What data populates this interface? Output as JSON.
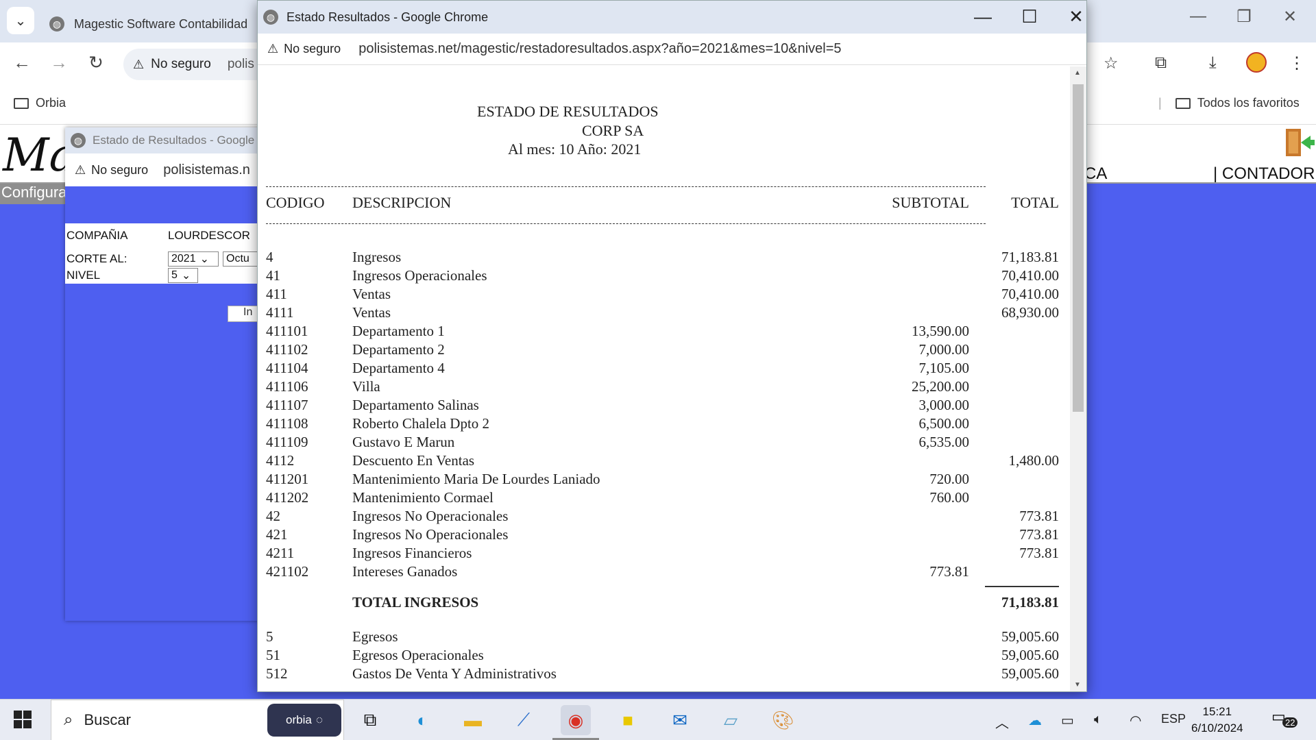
{
  "background_window": {
    "tab_title": "Magestic Software Contabilidad",
    "omnibox_warning": "No seguro",
    "omnibox_url": "polis",
    "bookmark_orbia": "Orbia",
    "bookmark_all": "Todos los favoritos"
  },
  "app": {
    "logo_text": "Ma",
    "menu_ca": "CA",
    "menu_contador": "| CONTADOR",
    "config_menu": "Configura"
  },
  "popup2": {
    "title": "Estado de Resultados - Google",
    "warning": "No seguro",
    "url": "polisistemas.n",
    "form": {
      "company_label": "COMPAÑIA",
      "company_value": "LOURDESCOR",
      "corte_label": "CORTE AL:",
      "year_value": "2021",
      "month_value": "Octu",
      "nivel_label": "NIVEL",
      "nivel_value": "5"
    },
    "button_label": "In"
  },
  "popup": {
    "title": "Estado Resultados - Google Chrome",
    "warning": "No seguro",
    "url": "polisistemas.net/magestic/restadoresultados.aspx?año=2021&mes=10&nivel=5"
  },
  "report": {
    "title": "ESTADO DE RESULTADOS",
    "company": "CORP SA",
    "period": "Al mes: 10 Año: 2021",
    "headers": {
      "codigo": "CODIGO",
      "descripcion": "DESCRIPCION",
      "subtotal": "SUBTOTAL",
      "total": "TOTAL"
    },
    "rows": [
      {
        "code": "4",
        "desc": "Ingresos",
        "subtotal": "",
        "total": "71,183.81"
      },
      {
        "code": "41",
        "desc": "Ingresos Operacionales",
        "subtotal": "",
        "total": "70,410.00"
      },
      {
        "code": "411",
        "desc": "Ventas",
        "subtotal": "",
        "total": "70,410.00"
      },
      {
        "code": "4111",
        "desc": "Ventas",
        "subtotal": "",
        "total": "68,930.00"
      },
      {
        "code": "411101",
        "desc": "Departamento 1",
        "subtotal": "13,590.00",
        "total": ""
      },
      {
        "code": "411102",
        "desc": "Departamento 2",
        "subtotal": "7,000.00",
        "total": ""
      },
      {
        "code": "411104",
        "desc": "Departamento 4",
        "subtotal": "7,105.00",
        "total": ""
      },
      {
        "code": "411106",
        "desc": "Villa",
        "subtotal": "25,200.00",
        "total": ""
      },
      {
        "code": "411107",
        "desc": "Departamento Salinas",
        "subtotal": "3,000.00",
        "total": ""
      },
      {
        "code": "411108",
        "desc": "Roberto Chalela Dpto 2",
        "subtotal": "6,500.00",
        "total": ""
      },
      {
        "code": "411109",
        "desc": "Gustavo E Marun",
        "subtotal": "6,535.00",
        "total": ""
      },
      {
        "code": "4112",
        "desc": "Descuento En Ventas",
        "subtotal": "",
        "total": "1,480.00"
      },
      {
        "code": "411201",
        "desc": "Mantenimiento Maria De Lourdes Laniado",
        "subtotal": "720.00",
        "total": ""
      },
      {
        "code": "411202",
        "desc": "Mantenimiento Cormael",
        "subtotal": "760.00",
        "total": ""
      },
      {
        "code": "42",
        "desc": "Ingresos No Operacionales",
        "subtotal": "",
        "total": "773.81"
      },
      {
        "code": "421",
        "desc": "Ingresos No Operacionales",
        "subtotal": "",
        "total": "773.81"
      },
      {
        "code": "4211",
        "desc": "Ingresos Financieros",
        "subtotal": "",
        "total": "773.81"
      },
      {
        "code": "421102",
        "desc": "Intereses Ganados",
        "subtotal": "773.81",
        "total": ""
      }
    ],
    "total_ingresos": {
      "label": "TOTAL INGRESOS",
      "value": "71,183.81"
    },
    "rows2": [
      {
        "code": "5",
        "desc": "Egresos",
        "subtotal": "",
        "total": "59,005.60"
      },
      {
        "code": "51",
        "desc": "Egresos Operacionales",
        "subtotal": "",
        "total": "59,005.60"
      },
      {
        "code": "512",
        "desc": "Gastos De Venta Y Administrativos",
        "subtotal": "",
        "total": "59,005.60"
      }
    ]
  },
  "taskbar": {
    "search_placeholder": "Buscar",
    "orbia_chip": "orbia",
    "lang": "ESP",
    "time": "15:21",
    "date": "6/10/2024",
    "notifications": "22"
  }
}
